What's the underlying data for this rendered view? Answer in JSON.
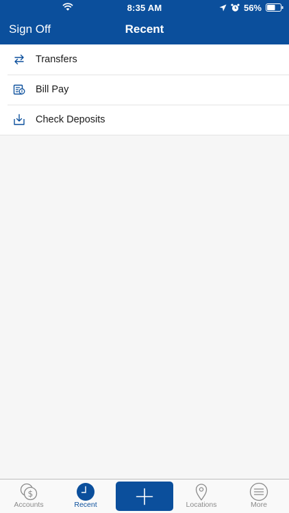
{
  "status_bar": {
    "time": "8:35 AM",
    "battery_percent": "56%"
  },
  "nav": {
    "left_action": "Sign Off",
    "title": "Recent"
  },
  "recent_items": [
    {
      "label": "Transfers",
      "icon": "transfer-arrows-icon"
    },
    {
      "label": "Bill Pay",
      "icon": "bill-pay-icon"
    },
    {
      "label": "Check Deposits",
      "icon": "download-tray-icon"
    }
  ],
  "tab_bar": {
    "tabs": [
      {
        "label": "Accounts",
        "icon": "dollar-coins-icon",
        "active": false
      },
      {
        "label": "Recent",
        "icon": "clock-icon",
        "active": true
      },
      {
        "label": "Locations",
        "icon": "map-pin-icon",
        "active": false
      },
      {
        "label": "More",
        "icon": "menu-lines-icon",
        "active": false
      }
    ],
    "center_button_icon": "plus-icon"
  },
  "colors": {
    "brand_blue": "#0b4f9c",
    "inactive_gray": "#8a8a8a",
    "background": "#f6f6f6"
  }
}
